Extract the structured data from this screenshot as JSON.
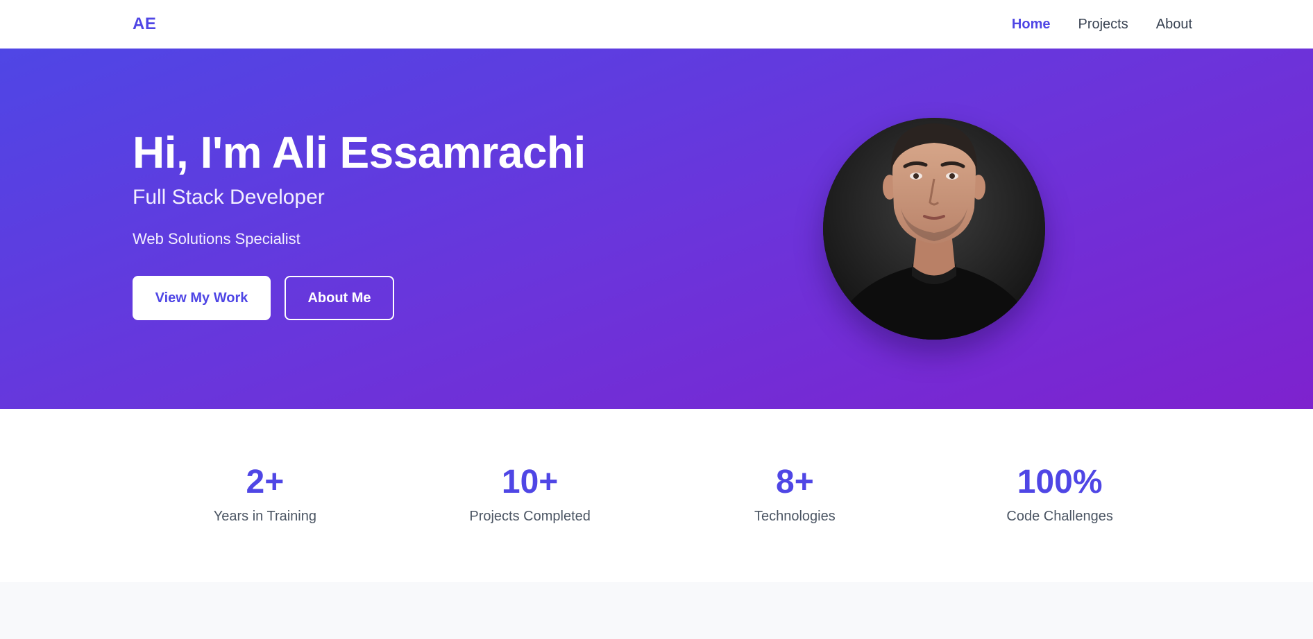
{
  "nav": {
    "logo": "AE",
    "links": [
      {
        "label": "Home",
        "active": true
      },
      {
        "label": "Projects",
        "active": false
      },
      {
        "label": "About",
        "active": false
      }
    ]
  },
  "hero": {
    "title": "Hi, I'm Ali Essamrachi",
    "subtitle": "Full Stack Developer",
    "tagline": "Web Solutions Specialist",
    "primary_button": "View My Work",
    "secondary_button": "About Me",
    "gradient_start": "#4f46e5",
    "gradient_end": "#7e22ce"
  },
  "stats": [
    {
      "value": "2+",
      "label": "Years in Training"
    },
    {
      "value": "10+",
      "label": "Projects Completed"
    },
    {
      "value": "8+",
      "label": "Technologies"
    },
    {
      "value": "100%",
      "label": "Code Challenges"
    }
  ],
  "colors": {
    "accent": "#4f46e5",
    "text_muted": "#4b5563"
  }
}
